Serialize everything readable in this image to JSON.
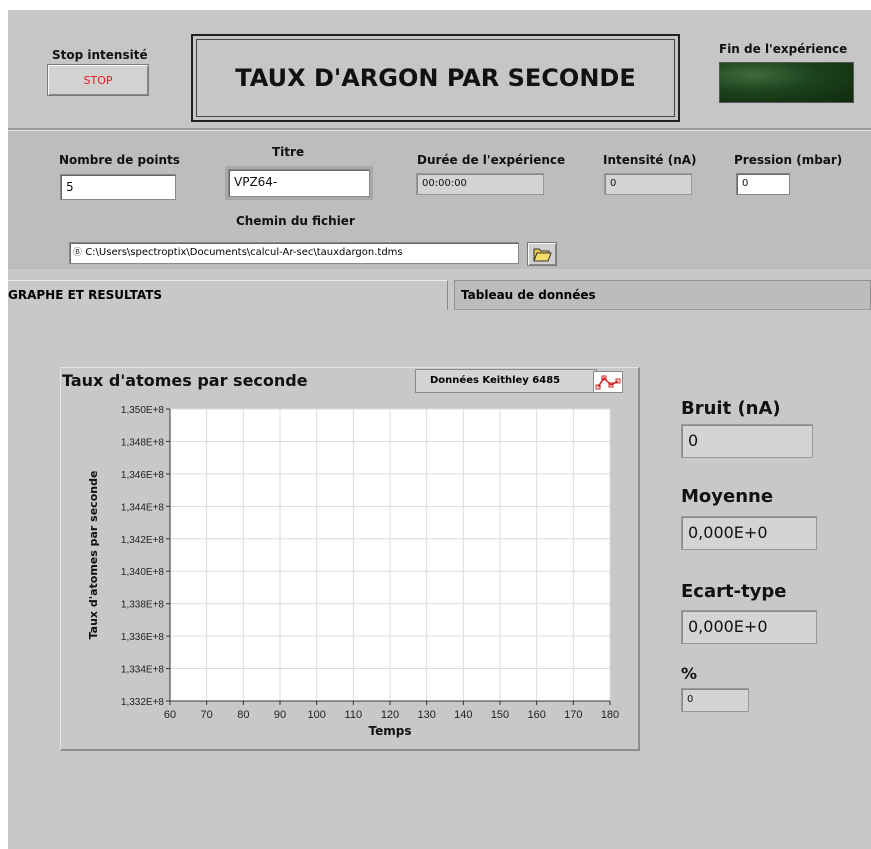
{
  "header": {
    "stop_label": "Stop intensité",
    "stop_button": "STOP",
    "title": "TAUX D'ARGON PAR SECONDE",
    "fin_label": "Fin de l'expérience"
  },
  "params": {
    "nombre_points_label": "Nombre de points",
    "nombre_points_value": "5",
    "titre_label": "Titre",
    "titre_value": "VPZ64-",
    "duree_label": "Durée de l'expérience",
    "duree_value": "00:00:00",
    "intensite_label": "Intensité (nA)",
    "intensite_value": "0",
    "pression_label": "Pression (mbar)",
    "pression_value": "0",
    "chemin_label": "Chemin du fichier",
    "chemin_value": "C:\\Users\\spectroptix\\Documents\\calcul-Ar-sec\\tauxdargon.tdms"
  },
  "tabs": [
    {
      "label": "GRAPHE ET RESULTATS",
      "active": true
    },
    {
      "label": "Tableau de données",
      "active": false
    }
  ],
  "chart_data": {
    "type": "line",
    "title": "Taux d'atomes par seconde",
    "legend": "Données Keithley 6485",
    "xlabel": "Temps",
    "ylabel": "Taux d'atomes par seconde",
    "xlim": [
      60,
      180
    ],
    "ylim": [
      133200000.0,
      135000000.0
    ],
    "x_ticks": [
      60,
      70,
      80,
      90,
      100,
      110,
      120,
      130,
      140,
      150,
      160,
      170,
      180
    ],
    "y_ticks": [
      133200000.0,
      133400000.0,
      133600000.0,
      133800000.0,
      134000000.0,
      134200000.0,
      134400000.0,
      134600000.0,
      134800000.0,
      135000000.0
    ],
    "x_tick_labels": [
      "60",
      "70",
      "80",
      "90",
      "100",
      "110",
      "120",
      "130",
      "140",
      "150",
      "160",
      "170",
      "180"
    ],
    "y_tick_labels": [
      "1,332E+8",
      "1,334E+8",
      "1,336E+8",
      "1,338E+8",
      "1,340E+8",
      "1,342E+8",
      "1,344E+8",
      "1,346E+8",
      "1,348E+8",
      "1,350E+8"
    ],
    "grid": true,
    "series": []
  },
  "results": {
    "bruit_label": "Bruit (nA)",
    "bruit_value": "0",
    "moyenne_label": "Moyenne",
    "moyenne_value": "0,000E+0",
    "ecart_label": "Ecart-type",
    "ecart_value": "0,000E+0",
    "pct_label": "%",
    "pct_value": "0"
  },
  "colors": {
    "panel_bg": "#c8c8c8",
    "stop_text": "#e01e1e",
    "led_off": "#1b421b",
    "plot_bg": "#ffffff",
    "grid": "#dcdcdc"
  }
}
